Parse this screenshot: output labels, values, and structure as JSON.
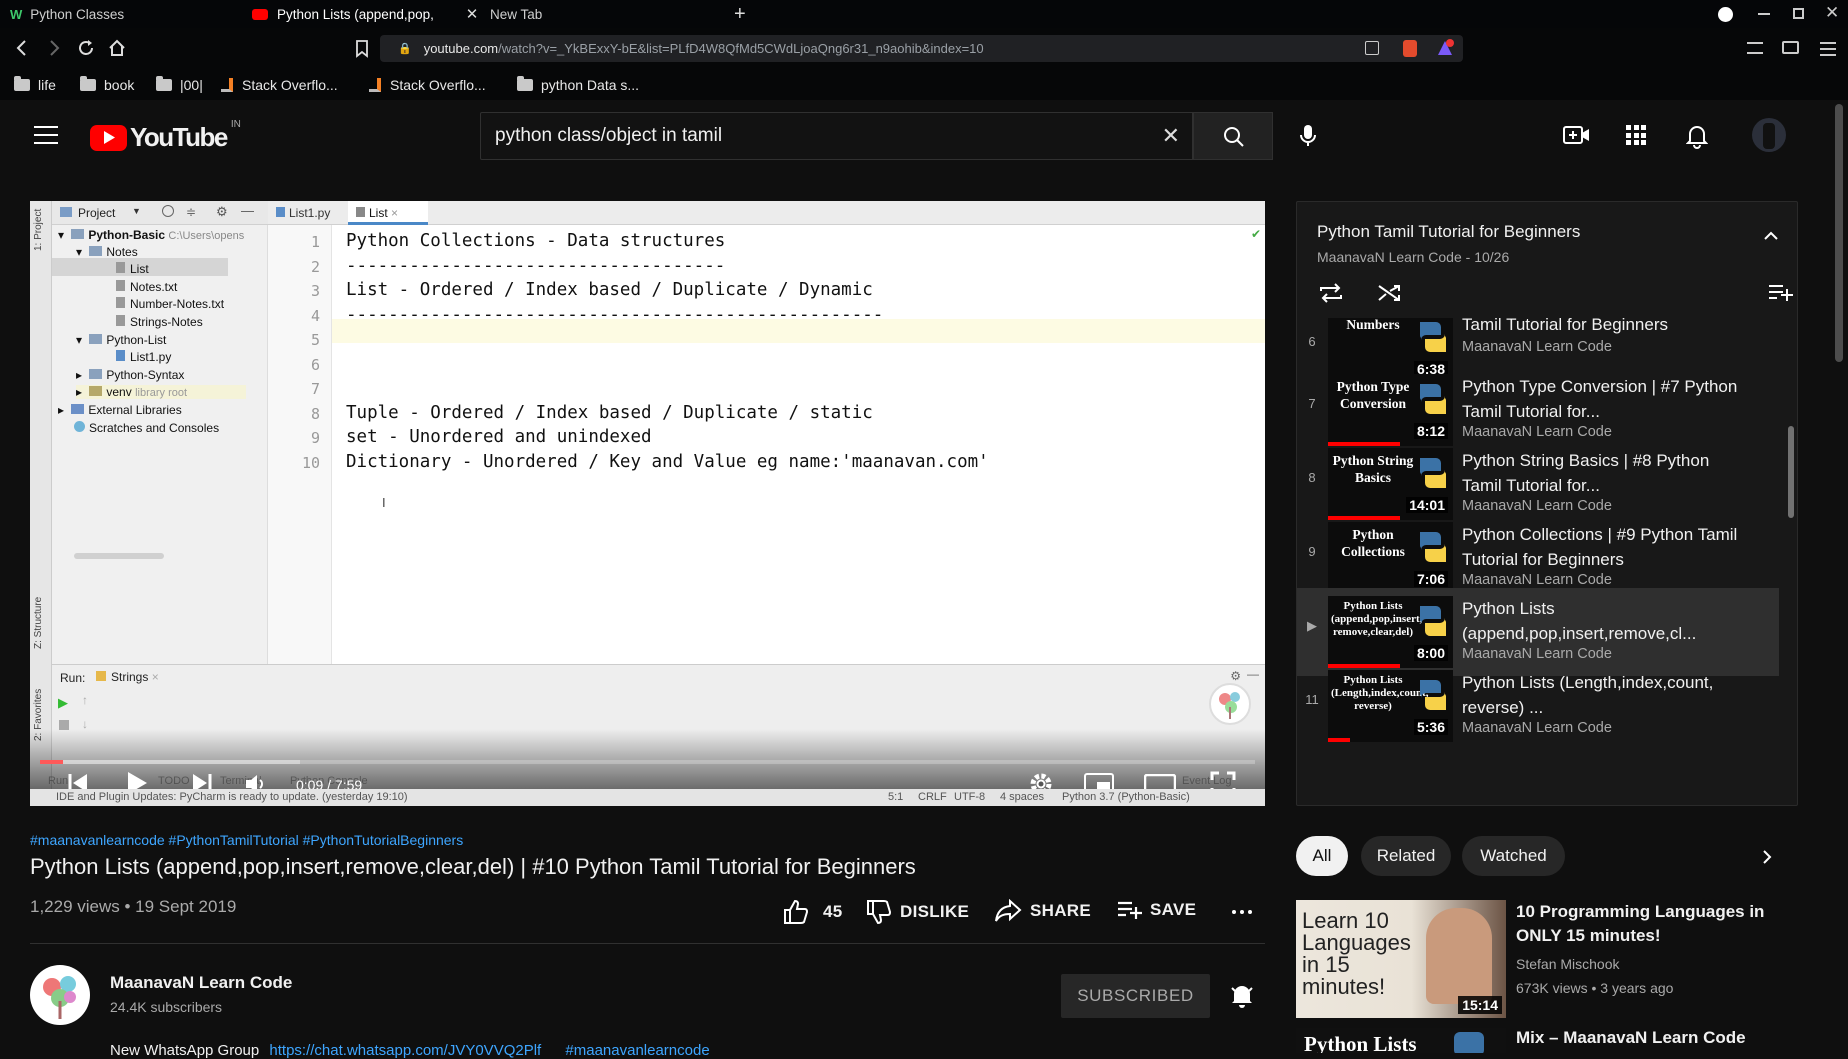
{
  "browser": {
    "tabs": [
      {
        "title": "Python Classes",
        "favicon": "w-icon"
      },
      {
        "title": "Python Lists (append,pop,",
        "favicon": "youtube-icon"
      },
      {
        "title": "New Tab"
      }
    ],
    "url_domain": "youtube.com",
    "url_path": "/watch?v=_YkBExxY-bE&list=PLfD4W8QfMd5CWdLjoaQng6r31_n9aohib&index=10",
    "bookmarks": [
      "life",
      "book",
      "|00|",
      "Stack Overflo...",
      "Stack Overflo...",
      "python Data s..."
    ]
  },
  "header": {
    "logo_text": "YouTube",
    "country": "IN",
    "search_value": "python class/object in tamil"
  },
  "ide": {
    "tabs": [
      "List1.py",
      "List"
    ],
    "project_label": "Project",
    "tree": [
      {
        "label": "Python-Basic",
        "extra": "C:\\Users\\opens"
      },
      {
        "label": "Notes"
      },
      {
        "label": "List"
      },
      {
        "label": "Notes.txt"
      },
      {
        "label": "Number-Notes.txt"
      },
      {
        "label": "Strings-Notes"
      },
      {
        "label": "Python-List"
      },
      {
        "label": "List1.py"
      },
      {
        "label": "Python-Syntax"
      },
      {
        "label": "venv",
        "extra": "library root"
      },
      {
        "label": "External Libraries"
      },
      {
        "label": "Scratches and Consoles"
      }
    ],
    "line_numbers": [
      "1",
      "2",
      "3",
      "4",
      "5",
      "6",
      "7",
      "8",
      "9",
      "10"
    ],
    "code_lines": [
      "Python Collections - Data structures",
      "------------------------------------",
      "List - Ordered / Index based / Duplicate / Dynamic",
      "---------------------------------------------------",
      "",
      "",
      "",
      "Tuple - Ordered / Index based / Duplicate / static",
      "set - Unordered and unindexed",
      "Dictionary - Unordered / Key and Value eg name:'maanavan.com'"
    ],
    "run_label": "Run:",
    "run_tab": "Strings",
    "side_labels": [
      "1: Project",
      "Z: Structure",
      "2: Favorites"
    ],
    "status_text": "IDE and Plugin Updates: PyCharm is ready to update. (yesterday 19:10)",
    "status_right": [
      "5:1",
      "CRLF",
      "UTF-8",
      "4 spaces",
      "Python 3.7 (Python-Basic)"
    ],
    "bottom_tabs": [
      "Run",
      "TODO",
      "Terminal",
      "Python Console",
      "Event Log"
    ]
  },
  "player": {
    "time": "0:09 / 7:59",
    "progress": 0.019
  },
  "video": {
    "hashtags": "#maanavanlearncode #PythonTamilTutorial #PythonTutorialBeginners",
    "title": "Python Lists (append,pop,insert,remove,clear,del) | #10 Python Tamil Tutorial for Beginners",
    "meta": "1,229 views • 19 Sept 2019",
    "likes": "45",
    "dislike": "DISLIKE",
    "share": "SHARE",
    "save": "SAVE"
  },
  "channel": {
    "name": "MaanavaN Learn Code",
    "subs": "24.4K subscribers",
    "subscribe_label": "SUBSCRIBED",
    "description_start": "New WhatsApp Group",
    "description_link": "https://chat.whatsapp.com/JVY0VVQ2Plf",
    "description_tag": "#maanavanlearncode"
  },
  "playlist": {
    "title": "Python Tamil Tutorial for Beginners",
    "subtitle": "MaanavaN Learn Code - 10/26",
    "items": [
      {
        "index": "6",
        "thumb": "Numbers",
        "duration": "6:38",
        "title": "Tamil Tutorial for Beginners",
        "channel": "MaanavaN Learn Code"
      },
      {
        "index": "7",
        "thumb": "Python Type Conversion",
        "duration": "8:12",
        "title": "Python Type Conversion | #7 Python Tamil Tutorial for...",
        "channel": "MaanavaN Learn Code"
      },
      {
        "index": "8",
        "thumb": "Python String Basics",
        "duration": "14:01",
        "title": "Python String Basics | #8 Python Tamil Tutorial for...",
        "channel": "MaanavaN Learn Code"
      },
      {
        "index": "9",
        "thumb": "Python Collections",
        "duration": "7:06",
        "title": "Python Collections | #9 Python Tamil Tutorial for Beginners",
        "channel": "MaanavaN Learn Code"
      },
      {
        "index": "▶",
        "thumb": "Python Lists (append,pop,insert, remove,clear,del)",
        "duration": "8:00",
        "title": "Python Lists (append,pop,insert,remove,cl...",
        "channel": "MaanavaN Learn Code"
      },
      {
        "index": "11",
        "thumb": "Python Lists (Length,index,count, reverse)",
        "duration": "5:36",
        "title": "Python Lists (Length,index,count, reverse) ...",
        "channel": "MaanavaN Learn Code"
      }
    ]
  },
  "chips": [
    "All",
    "Related",
    "Watched"
  ],
  "related": [
    {
      "thumb": "Learn 10 Languages in 15 minutes!",
      "duration": "15:14",
      "title": "10 Programming Languages in ONLY 15 minutes!",
      "channel": "Stefan Mischook",
      "meta": "673K views • 3 years ago"
    },
    {
      "thumb": "Python Lists",
      "title": "Mix – MaanavaN Learn Code"
    }
  ],
  "colors": {
    "accent_red": "#ff0000",
    "link_blue": "#3ea6ff",
    "bg": "#0f0f0f"
  }
}
